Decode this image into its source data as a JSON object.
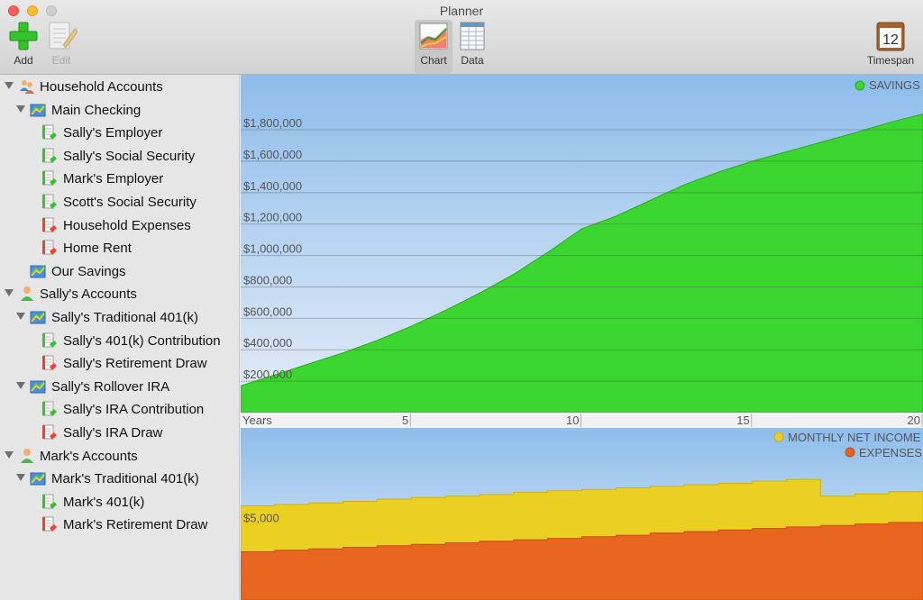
{
  "window": {
    "title": "Planner"
  },
  "toolbar": {
    "add_label": "Add",
    "edit_label": "Edit",
    "chart_label": "Chart",
    "data_label": "Data",
    "timespan_label": "Timespan",
    "timespan_value": "12"
  },
  "sidebar": {
    "items": [
      {
        "label": "Household Accounts",
        "level": 0,
        "kind": "group",
        "expanded": true
      },
      {
        "label": "Main Checking",
        "level": 1,
        "kind": "account",
        "expanded": true
      },
      {
        "label": "Sally's Employer",
        "level": 2,
        "kind": "income"
      },
      {
        "label": "Sally's Social Security",
        "level": 2,
        "kind": "income"
      },
      {
        "label": "Mark's Employer",
        "level": 2,
        "kind": "income"
      },
      {
        "label": "Scott's Social Security",
        "level": 2,
        "kind": "income"
      },
      {
        "label": "Household Expenses",
        "level": 2,
        "kind": "expense"
      },
      {
        "label": "Home Rent",
        "level": 2,
        "kind": "expense"
      },
      {
        "label": "Our Savings",
        "level": 1,
        "kind": "account",
        "expanded": false
      },
      {
        "label": "Sally's Accounts",
        "level": 0,
        "kind": "person",
        "expanded": true
      },
      {
        "label": "Sally's Traditional 401(k)",
        "level": 1,
        "kind": "account",
        "expanded": true
      },
      {
        "label": "Sally's 401(k) Contribution",
        "level": 2,
        "kind": "income"
      },
      {
        "label": "Sally's Retirement Draw",
        "level": 2,
        "kind": "expense"
      },
      {
        "label": "Sally's Rollover IRA",
        "level": 1,
        "kind": "account",
        "expanded": true
      },
      {
        "label": "Sally's IRA Contribution",
        "level": 2,
        "kind": "income"
      },
      {
        "label": "Sally's IRA Draw",
        "level": 2,
        "kind": "expense"
      },
      {
        "label": "Mark's Accounts",
        "level": 0,
        "kind": "person",
        "expanded": true
      },
      {
        "label": "Mark's Traditional 401(k)",
        "level": 1,
        "kind": "account",
        "expanded": true
      },
      {
        "label": "Mark's 401(k)",
        "level": 2,
        "kind": "income"
      },
      {
        "label": "Mark's Retirement Draw",
        "level": 2,
        "kind": "expense"
      }
    ]
  },
  "colors": {
    "savings": "#3cd630",
    "income": "#ebd023",
    "expenses": "#e8651f",
    "sky_top": "#8dbdec",
    "sky_bottom": "#e6edf7"
  },
  "chart_data": [
    {
      "type": "area",
      "series": [
        {
          "name": "SAVINGS",
          "x": [
            0,
            1,
            2,
            3,
            4,
            5,
            6,
            7,
            8,
            9,
            10,
            11,
            12,
            13,
            14,
            15,
            16,
            17,
            18,
            19,
            20
          ],
          "values": [
            170000,
            240000,
            310000,
            380000,
            460000,
            550000,
            650000,
            760000,
            880000,
            1020000,
            1170000,
            1250000,
            1350000,
            1450000,
            1530000,
            1600000,
            1660000,
            1720000,
            1780000,
            1845000,
            1900000
          ]
        }
      ],
      "yticks": [
        "$200,000",
        "$400,000",
        "$600,000",
        "$800,000",
        "$1,000,000",
        "$1,200,000",
        "$1,400,000",
        "$1,600,000",
        "$1,800,000"
      ],
      "ytick_values": [
        200000,
        400000,
        600000,
        800000,
        1000000,
        1200000,
        1400000,
        1600000,
        1800000
      ],
      "ylim": [
        0,
        1800000
      ],
      "xlabel": "Years",
      "xticks": [
        "5",
        "10",
        "15",
        "20"
      ],
      "xtick_values": [
        5,
        10,
        15,
        20
      ],
      "xlim": [
        0,
        20
      ],
      "grid": true,
      "legend": "top-right"
    },
    {
      "type": "area",
      "series": [
        {
          "name": "MONTHLY NET INCOME",
          "values": [
            6250,
            6350,
            6450,
            6550,
            6700,
            6800,
            6900,
            7000,
            7150,
            7250,
            7350,
            7450,
            7550,
            7650,
            7750,
            7900,
            8000,
            6900,
            7050,
            7200,
            7350
          ]
        },
        {
          "name": "EXPENSES",
          "values": [
            3200,
            3300,
            3400,
            3500,
            3600,
            3700,
            3800,
            3900,
            4000,
            4100,
            4200,
            4300,
            4450,
            4550,
            4650,
            4750,
            4850,
            4950,
            5050,
            5150,
            5250
          ]
        }
      ],
      "x": [
        0,
        1,
        2,
        3,
        4,
        5,
        6,
        7,
        8,
        9,
        10,
        11,
        12,
        13,
        14,
        15,
        16,
        17,
        18,
        19,
        20
      ],
      "yticks": [
        "$5,000"
      ],
      "ytick_values": [
        5000
      ],
      "ylim": [
        0,
        12000
      ],
      "grid": false,
      "legend": "top-right"
    }
  ]
}
